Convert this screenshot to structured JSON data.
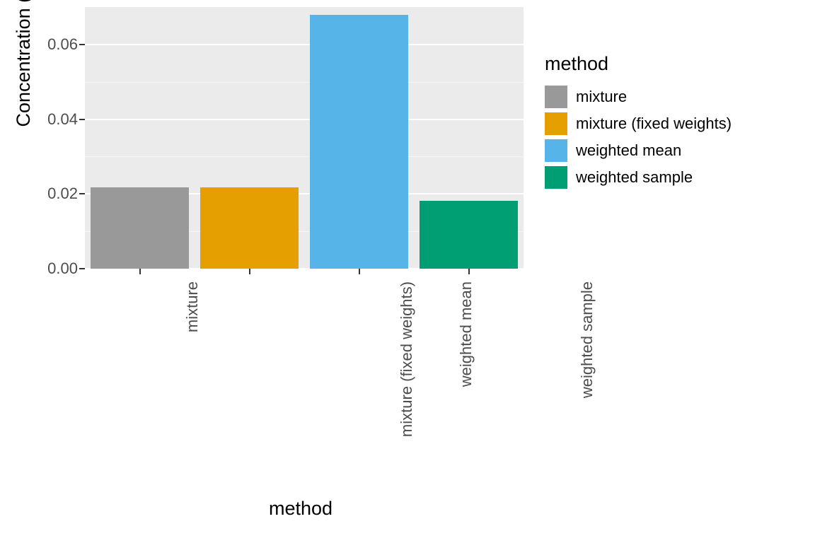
{
  "chart_data": {
    "type": "bar",
    "title": "",
    "xlabel": "method",
    "ylabel": "Concentration (LCL)",
    "ylim": [
      0,
      0.07
    ],
    "y_major_ticks": [
      0.0,
      0.02,
      0.04,
      0.06
    ],
    "y_minor_ticks": [
      0.01,
      0.03,
      0.05
    ],
    "categories": [
      "mixture",
      "mixture (fixed weights)",
      "weighted mean",
      "weighted sample"
    ],
    "series": [
      {
        "name": "mixture",
        "color": "#999999",
        "values": [
          0.0217,
          null,
          null,
          null
        ]
      },
      {
        "name": "mixture (fixed weights)",
        "color": "#E69F00",
        "values": [
          null,
          0.0217,
          null,
          null
        ]
      },
      {
        "name": "weighted mean",
        "color": "#56B4E9",
        "values": [
          null,
          null,
          0.068,
          null
        ]
      },
      {
        "name": "weighted sample",
        "color": "#009E73",
        "values": [
          null,
          null,
          null,
          0.0182
        ]
      }
    ],
    "legend_title": "method",
    "legend": [
      {
        "label": "mixture",
        "color": "#999999"
      },
      {
        "label": "mixture (fixed weights)",
        "color": "#E69F00"
      },
      {
        "label": "weighted mean",
        "color": "#56B4E9"
      },
      {
        "label": "weighted sample",
        "color": "#009E73"
      }
    ]
  },
  "y_tick_labels": [
    "0.00",
    "0.02",
    "0.04",
    "0.06"
  ]
}
